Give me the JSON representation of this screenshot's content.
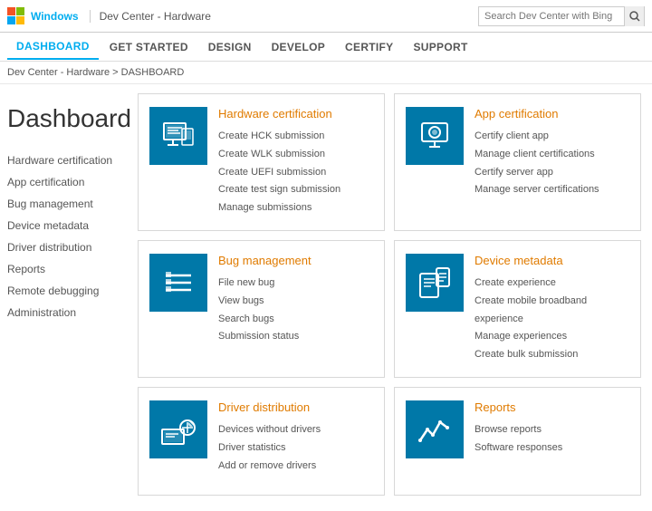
{
  "topbar": {
    "windows_label": "Windows",
    "site_title": "Dev Center - Hardware",
    "search_placeholder": "Search Dev Center with Bing"
  },
  "nav": {
    "items": [
      {
        "label": "DASHBOARD",
        "active": true
      },
      {
        "label": "GET STARTED",
        "active": false
      },
      {
        "label": "DESIGN",
        "active": false
      },
      {
        "label": "DEVELOP",
        "active": false
      },
      {
        "label": "CERTIFY",
        "active": false
      },
      {
        "label": "SUPPORT",
        "active": false
      }
    ]
  },
  "breadcrumb": {
    "parts": [
      "Dev Center - Hardware",
      "DASHBOARD"
    ],
    "text": "Dev Center - Hardware > DASHBOARD"
  },
  "page_title": "Dashboard",
  "sidebar": {
    "items": [
      {
        "label": "Hardware certification"
      },
      {
        "label": "App certification"
      },
      {
        "label": "Bug management"
      },
      {
        "label": "Device metadata"
      },
      {
        "label": "Driver distribution"
      },
      {
        "label": "Reports"
      },
      {
        "label": "Remote debugging"
      },
      {
        "label": "Administration"
      }
    ]
  },
  "cards": [
    {
      "id": "hardware-certification",
      "title": "Hardware certification",
      "icon": "hardware-cert-icon",
      "links": [
        "Create HCK submission",
        "Create WLK submission",
        "Create UEFI submission",
        "Create test sign submission",
        "Manage submissions"
      ]
    },
    {
      "id": "app-certification",
      "title": "App certification",
      "icon": "app-cert-icon",
      "links": [
        "Certify client app",
        "Manage client certifications",
        "Certify server app",
        "Manage server certifications"
      ]
    },
    {
      "id": "bug-management",
      "title": "Bug management",
      "icon": "bug-management-icon",
      "links": [
        "File new bug",
        "View bugs",
        "Search bugs",
        "Submission status"
      ]
    },
    {
      "id": "device-metadata",
      "title": "Device metadata",
      "icon": "device-metadata-icon",
      "links": [
        "Create experience",
        "Create mobile broadband experience",
        "Manage experiences",
        "Create bulk submission"
      ]
    },
    {
      "id": "driver-distribution",
      "title": "Driver distribution",
      "icon": "driver-dist-icon",
      "links": [
        "Devices without drivers",
        "Driver statistics",
        "Add or remove drivers"
      ]
    },
    {
      "id": "reports",
      "title": "Reports",
      "icon": "reports-icon",
      "links": [
        "Browse reports",
        "Software responses"
      ]
    }
  ]
}
